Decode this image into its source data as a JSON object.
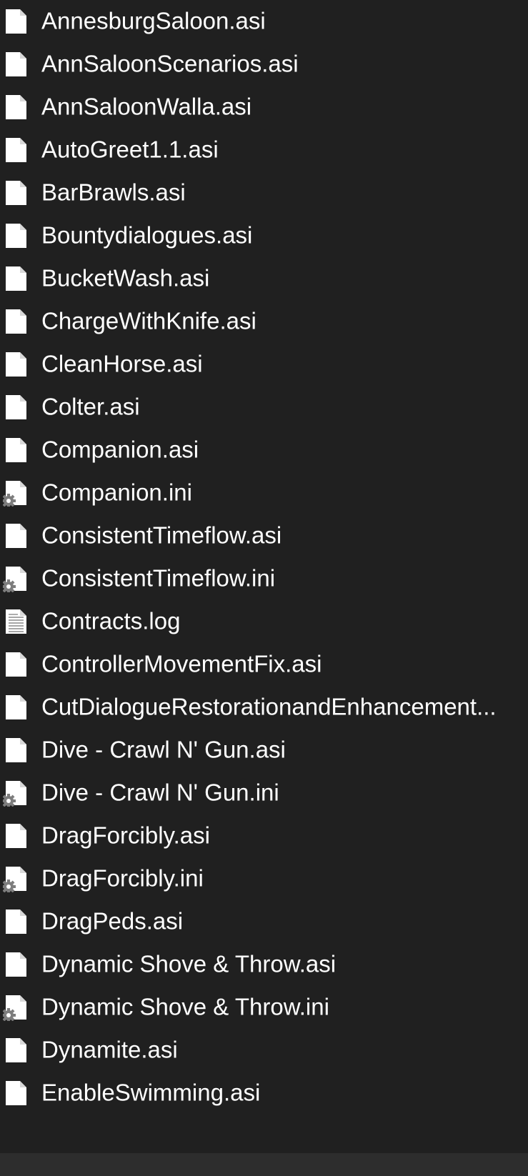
{
  "files": [
    {
      "name": "AnnesburgSaloon.asi",
      "icon": "blank-file-icon"
    },
    {
      "name": "AnnSaloonScenarios.asi",
      "icon": "blank-file-icon"
    },
    {
      "name": "AnnSaloonWalla.asi",
      "icon": "blank-file-icon"
    },
    {
      "name": "AutoGreet1.1.asi",
      "icon": "blank-file-icon"
    },
    {
      "name": "BarBrawls.asi",
      "icon": "blank-file-icon"
    },
    {
      "name": "Bountydialogues.asi",
      "icon": "blank-file-icon"
    },
    {
      "name": "BucketWash.asi",
      "icon": "blank-file-icon"
    },
    {
      "name": "ChargeWithKnife.asi",
      "icon": "blank-file-icon"
    },
    {
      "name": "CleanHorse.asi",
      "icon": "blank-file-icon"
    },
    {
      "name": "Colter.asi",
      "icon": "blank-file-icon"
    },
    {
      "name": "Companion.asi",
      "icon": "blank-file-icon"
    },
    {
      "name": "Companion.ini",
      "icon": "config-file-icon"
    },
    {
      "name": "ConsistentTimeflow.asi",
      "icon": "blank-file-icon"
    },
    {
      "name": "ConsistentTimeflow.ini",
      "icon": "config-file-icon"
    },
    {
      "name": "Contracts.log",
      "icon": "text-file-icon"
    },
    {
      "name": "ControllerMovementFix.asi",
      "icon": "blank-file-icon"
    },
    {
      "name": "CutDialogueRestorationandEnhancement...",
      "icon": "blank-file-icon"
    },
    {
      "name": "Dive - Crawl N' Gun.asi",
      "icon": "blank-file-icon"
    },
    {
      "name": "Dive - Crawl N' Gun.ini",
      "icon": "config-file-icon"
    },
    {
      "name": "DragForcibly.asi",
      "icon": "blank-file-icon"
    },
    {
      "name": "DragForcibly.ini",
      "icon": "config-file-icon"
    },
    {
      "name": "DragPeds.asi",
      "icon": "blank-file-icon"
    },
    {
      "name": "Dynamic Shove & Throw.asi",
      "icon": "blank-file-icon"
    },
    {
      "name": "Dynamic Shove & Throw.ini",
      "icon": "config-file-icon"
    },
    {
      "name": "Dynamite.asi",
      "icon": "blank-file-icon"
    },
    {
      "name": "EnableSwimming.asi",
      "icon": "blank-file-icon"
    }
  ]
}
